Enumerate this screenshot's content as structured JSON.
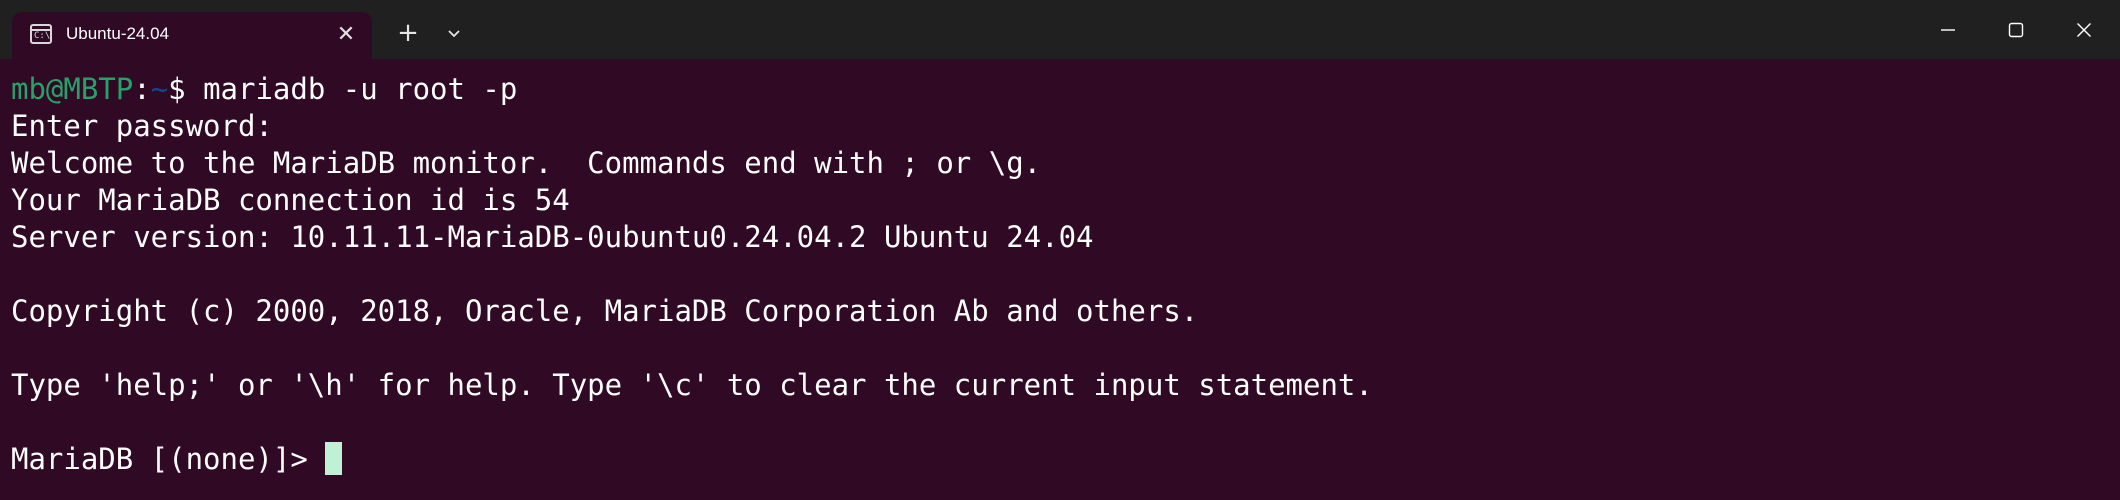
{
  "tab": {
    "title": "Ubuntu-24.04",
    "icon": "terminal-icon",
    "icon_glyph": "C:\\",
    "close_glyph": "✕"
  },
  "toolbar": {
    "new_tab_glyph": "+",
    "dropdown_icon": "chevron-down-icon"
  },
  "window_controls": {
    "minimize_icon": "minimize-icon",
    "maximize_icon": "maximize-icon",
    "close_icon": "close-icon"
  },
  "terminal": {
    "prompt": {
      "user_host": "mb@MBTP",
      "separator": ":",
      "path": "~",
      "dollar": "$",
      "command": " mariadb -u root -p"
    },
    "output": [
      "Enter password:",
      "Welcome to the MariaDB monitor.  Commands end with ; or \\g.",
      "Your MariaDB connection id is 54",
      "Server version: 10.11.11-MariaDB-0ubuntu0.24.04.2 Ubuntu 24.04",
      "",
      "Copyright (c) 2000, 2018, Oracle, MariaDB Corporation Ab and others.",
      "",
      "Type 'help;' or '\\h' for help. Type '\\c' to clear the current input statement.",
      ""
    ],
    "mariadb_prompt": "MariaDB [(none)]> "
  },
  "colors": {
    "terminal_bg": "#300a24",
    "titlebar_bg": "#202020",
    "prompt_user": "#26a269",
    "prompt_path": "#12488b",
    "cursor": "#bff2d4"
  }
}
